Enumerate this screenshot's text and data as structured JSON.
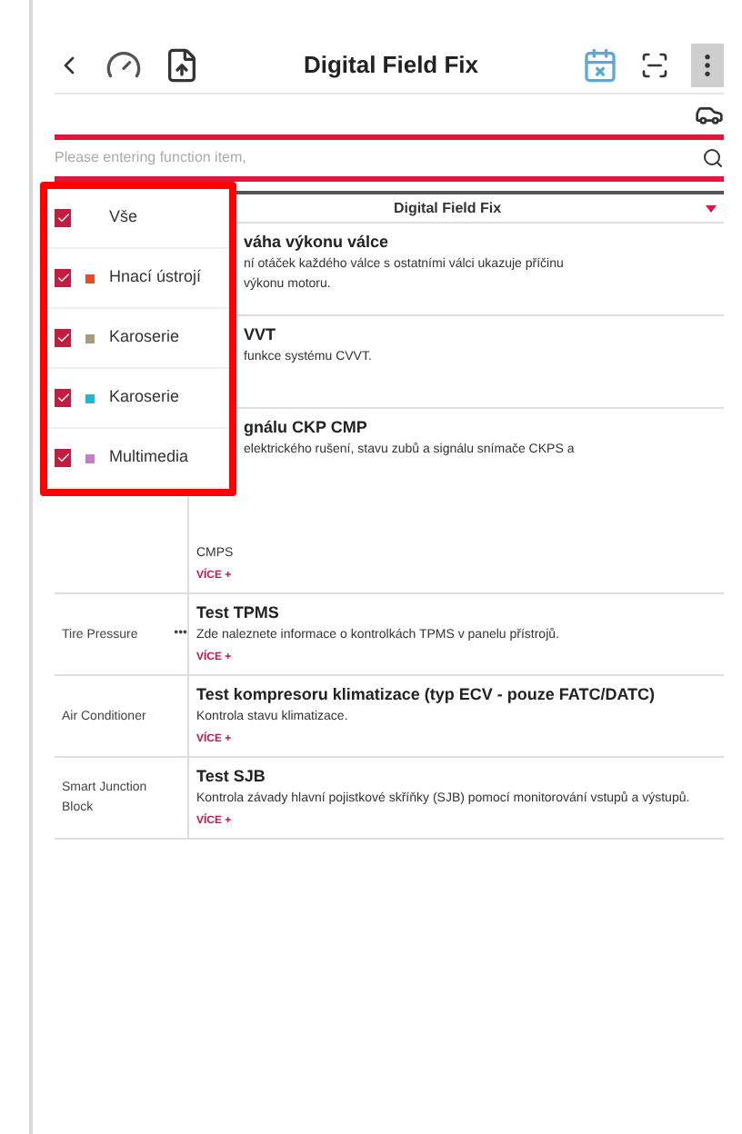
{
  "header": {
    "title": "Digital Field Fix"
  },
  "search": {
    "placeholder": "Please entering function item,"
  },
  "table": {
    "column_2": "Digital Field Fix",
    "rows": [
      {
        "system": "",
        "title": "váha výkonu válce",
        "lines": [
          "ní otáček každého válce s ostatními válci ukazuje příčinu",
          "výkonu motoru."
        ],
        "more": "",
        "kind": "partial"
      },
      {
        "system": "",
        "title": "VVT",
        "lines": [
          "funkce systému CVVT."
        ],
        "more": "",
        "kind": "partial"
      },
      {
        "system": "",
        "title": "gnálu CKP CMP",
        "lines": [
          "elektrického rušení, stavu zubů a signálu snímače CKPS a"
        ],
        "tail": "CMPS",
        "more": "VÍCE +",
        "kind": "partial"
      },
      {
        "system": "Tire Pressure",
        "dots": "•••",
        "title": "Test TPMS",
        "lines": [
          "Zde naleznete informace o kontrolkách TPMS v panelu přístrojů."
        ],
        "more": "VÍCE +",
        "kind": "full"
      },
      {
        "system": "Air Conditioner",
        "title": "Test kompresoru klimatizace (typ ECV - pouze FATC/DATC)",
        "lines": [
          "Kontrola stavu klimatizace."
        ],
        "more": "VÍCE +",
        "kind": "full"
      },
      {
        "system": "Smart Junction Block",
        "title": "Test SJB",
        "lines": [
          "Kontrola závady hlavní pojistkové skříňky (SJB) pomocí monitorování vstupů a výstupů."
        ],
        "more": "VÍCE +",
        "kind": "full"
      }
    ]
  },
  "filter_menu": {
    "items": [
      {
        "label": "Vše",
        "checked": true
      },
      {
        "label": "Hnací ústrojí",
        "checked": true,
        "color": "#e0502a"
      },
      {
        "label": "Karoserie",
        "checked": true,
        "color": "#a89a7a"
      },
      {
        "label": "Karoserie",
        "checked": true,
        "color": "#27b5d6"
      },
      {
        "label": "Multimedia",
        "checked": true,
        "color": "#c77cc9"
      }
    ]
  }
}
